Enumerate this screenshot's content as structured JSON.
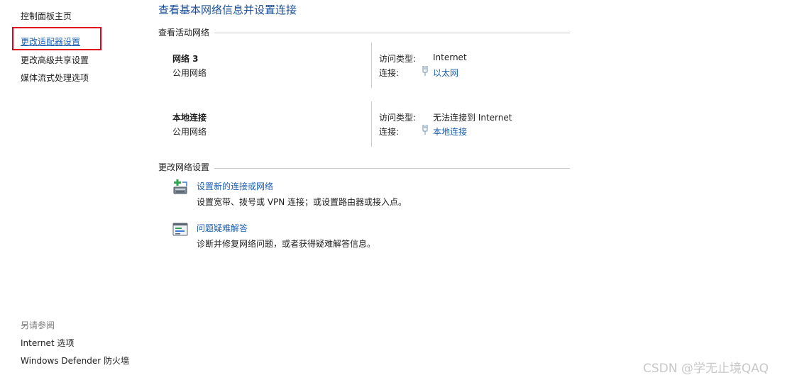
{
  "sidebar": {
    "items": [
      {
        "label": "控制面板主页"
      },
      {
        "label": "更改适配器设置"
      },
      {
        "label": "更改高级共享设置"
      },
      {
        "label": "媒体流式处理选项"
      }
    ],
    "see_also_title": "另请参阅",
    "see_also": [
      {
        "label": "Internet 选项"
      },
      {
        "label": "Windows Defender 防火墙"
      }
    ]
  },
  "main": {
    "title": "查看基本网络信息并设置连接",
    "active_networks_heading": "查看活动网络",
    "networks": [
      {
        "name": "网络 3",
        "type": "公用网络",
        "access_type_label": "访问类型:",
        "access_type_value": "Internet",
        "connection_label": "连接:",
        "connection_value": "以太网"
      },
      {
        "name": "本地连接",
        "type": "公用网络",
        "access_type_label": "访问类型:",
        "access_type_value": "无法连接到 Internet",
        "connection_label": "连接:",
        "connection_value": "本地连接"
      }
    ],
    "change_settings_heading": "更改网络设置",
    "tasks": [
      {
        "link": "设置新的连接或网络",
        "desc": "设置宽带、拨号或 VPN 连接；或设置路由器或接入点。",
        "icon": "new-connection-icon"
      },
      {
        "link": "问题疑难解答",
        "desc": "诊断并修复网络问题，或者获得疑难解答信息。",
        "icon": "troubleshoot-icon"
      }
    ]
  },
  "watermark": "CSDN @学无止境QAQ",
  "colors": {
    "link": "#1a5fb4",
    "title": "#1b4f9a",
    "highlight": "#e0001b"
  }
}
